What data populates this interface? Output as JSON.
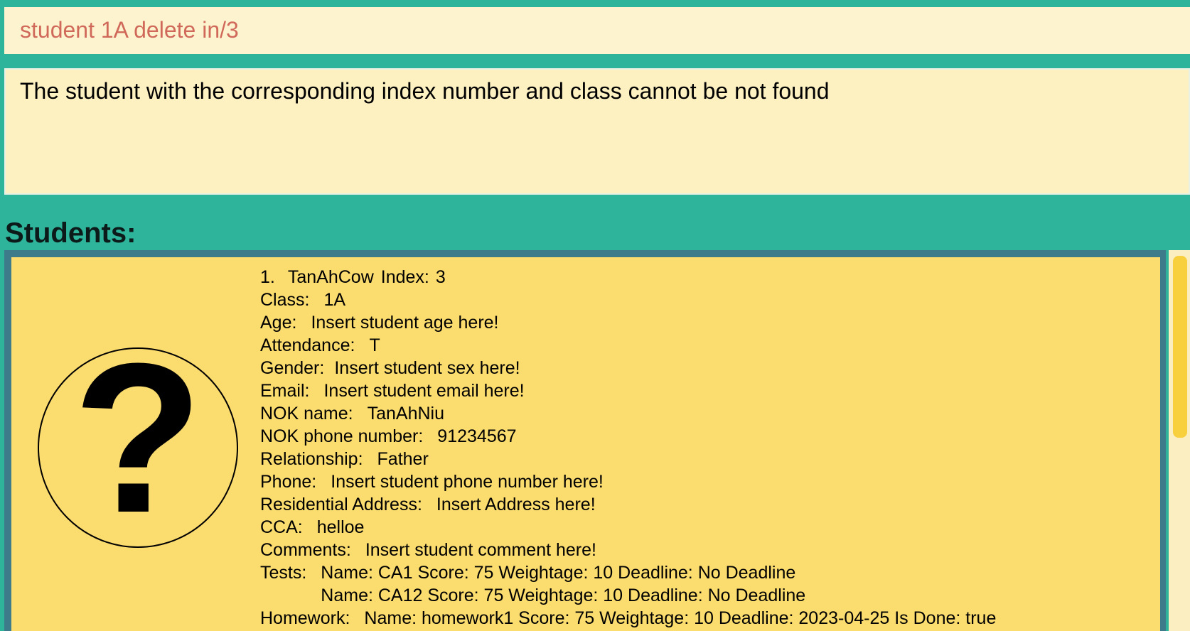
{
  "command_box": {
    "text": "student 1A delete in/3"
  },
  "result_box": {
    "text": "The student with the corresponding index number and class cannot be not found"
  },
  "students_panel": {
    "title": "Students:"
  },
  "student": {
    "number": "1.",
    "name": "TanAhCow",
    "index_label": "Index:",
    "index_value": "3",
    "class_label": "Class:",
    "class_value": "1A",
    "age_label": "Age:",
    "age_value": "Insert student age here!",
    "attendance_label": "Attendance:",
    "attendance_value": "T",
    "gender_label": "Gender:",
    "gender_value": "Insert student sex here!",
    "email_label": "Email:",
    "email_value": "Insert student email here!",
    "nok_name_label": "NOK name:",
    "nok_name_value": "TanAhNiu",
    "nok_phone_label": "NOK phone number:",
    "nok_phone_value": "91234567",
    "relationship_label": "Relationship:",
    "relationship_value": "Father",
    "phone_label": "Phone:",
    "phone_value": "Insert student phone number here!",
    "address_label": "Residential Address:",
    "address_value": "Insert Address here!",
    "cca_label": "CCA:",
    "cca_value": "helloe",
    "comments_label": "Comments:",
    "comments_value": "Insert student comment here!",
    "tests_label": "Tests:",
    "tests": [
      "Name: CA1   Score: 75 Weightage: 10 Deadline: No Deadline",
      "Name: CA12 Score: 75 Weightage: 10 Deadline: No Deadline"
    ],
    "homework_label": "Homework:",
    "homework_value": "Name: homework1 Score: 75 Weightage: 10 Deadline: 2023-04-25 Is Done: true",
    "photo_icon": "question-mark-icon"
  },
  "colors": {
    "background": "#2db49b",
    "command_text": "#d0695a",
    "card": "#fbdc6e",
    "list_frame": "#3d7a8a",
    "scroll_thumb": "#f8cf3c"
  }
}
